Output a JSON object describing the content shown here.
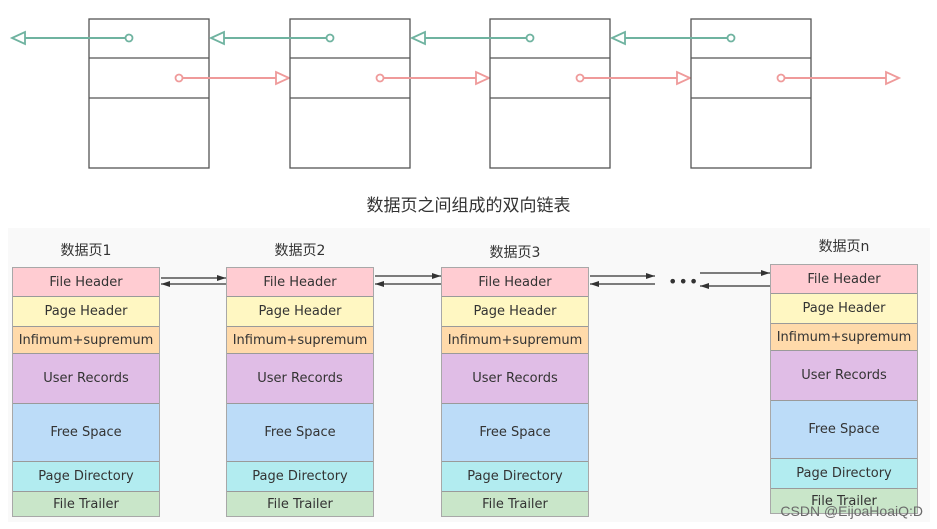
{
  "top_diagram": {
    "page_count": 4,
    "prev_pointer_color": "#6fb3a0",
    "next_pointer_color": "#ef9a9a",
    "box_stroke": "#555555"
  },
  "caption": "数据页之间组成的双向链表",
  "pages": [
    {
      "title": "数据页1"
    },
    {
      "title": "数据页2"
    },
    {
      "title": "数据页3"
    },
    {
      "title": "数据页n"
    }
  ],
  "segments": [
    {
      "label": "File Header",
      "color": "#ffccd2"
    },
    {
      "label": "Page Header",
      "color": "#fff7c2"
    },
    {
      "label": "Infimum+supremum",
      "color": "#ffdaaa"
    },
    {
      "label": "User Records",
      "color": "#e0bde6"
    },
    {
      "label": "Free Space",
      "color": "#bcdcf8"
    },
    {
      "label": "Page Directory",
      "color": "#b2ecf0"
    },
    {
      "label": "File Trailer",
      "color": "#c9e6c9"
    }
  ],
  "ellipsis": "•••",
  "watermark": "CSDN @EijoaHoaiQ:D"
}
